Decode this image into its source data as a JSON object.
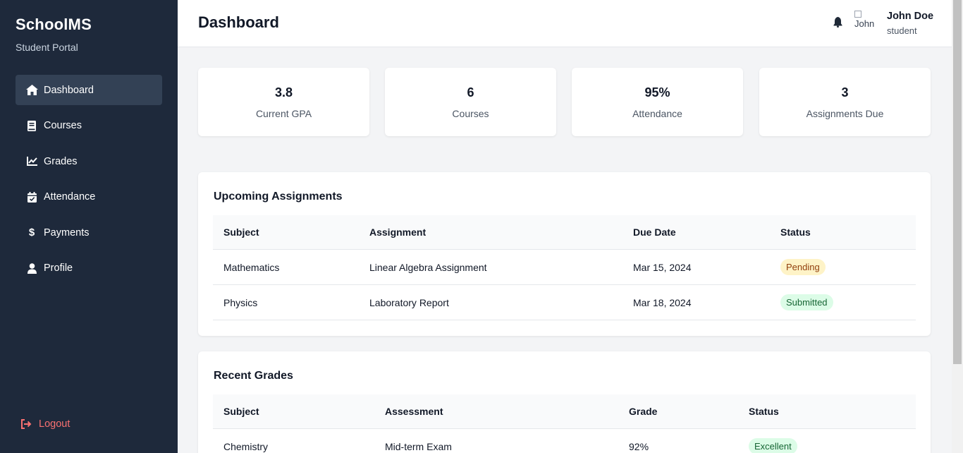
{
  "sidebar": {
    "brand": "SchoolMS",
    "subtitle": "Student Portal",
    "items": [
      {
        "label": "Dashboard",
        "icon": "home-icon",
        "active": true
      },
      {
        "label": "Courses",
        "icon": "book-icon",
        "active": false
      },
      {
        "label": "Grades",
        "icon": "chart-line-icon",
        "active": false
      },
      {
        "label": "Attendance",
        "icon": "calendar-check-icon",
        "active": false
      },
      {
        "label": "Payments",
        "icon": "dollar-icon",
        "active": false
      },
      {
        "label": "Profile",
        "icon": "user-icon",
        "active": false
      }
    ],
    "logout_label": "Logout"
  },
  "header": {
    "title": "Dashboard",
    "avatar_alt": "John",
    "user_name": "John Doe",
    "user_role": "student"
  },
  "stats": [
    {
      "value": "3.8",
      "label": "Current GPA"
    },
    {
      "value": "6",
      "label": "Courses"
    },
    {
      "value": "95%",
      "label": "Attendance"
    },
    {
      "value": "3",
      "label": "Assignments Due"
    }
  ],
  "assignments": {
    "title": "Upcoming Assignments",
    "columns": [
      "Subject",
      "Assignment",
      "Due Date",
      "Status"
    ],
    "rows": [
      {
        "subject": "Mathematics",
        "assignment": "Linear Algebra Assignment",
        "due": "Mar 15, 2024",
        "status": "Pending"
      },
      {
        "subject": "Physics",
        "assignment": "Laboratory Report",
        "due": "Mar 18, 2024",
        "status": "Submitted"
      }
    ]
  },
  "grades": {
    "title": "Recent Grades",
    "columns": [
      "Subject",
      "Assessment",
      "Grade",
      "Status"
    ],
    "rows": [
      {
        "subject": "Chemistry",
        "assessment": "Mid-term Exam",
        "grade": "92%",
        "status": "Excellent"
      }
    ]
  },
  "colors": {
    "sidebar_bg": "#1e293b",
    "sidebar_active": "#334155",
    "logout": "#f87171",
    "pending_bg": "#fef3c7",
    "success_bg": "#dcfce7"
  }
}
